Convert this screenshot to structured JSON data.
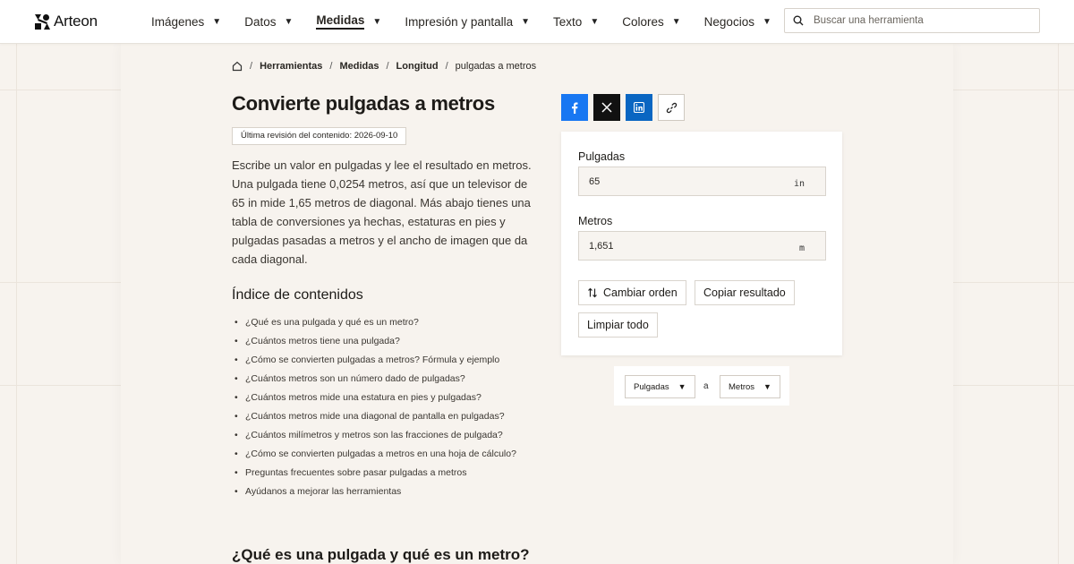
{
  "brand": {
    "name": "Arteon"
  },
  "nav": [
    {
      "label": "Imágenes",
      "active": false
    },
    {
      "label": "Datos",
      "active": false
    },
    {
      "label": "Medidas",
      "active": true
    },
    {
      "label": "Impresión y pantalla",
      "active": false
    },
    {
      "label": "Texto",
      "active": false
    },
    {
      "label": "Colores",
      "active": false
    },
    {
      "label": "Negocios",
      "active": false
    }
  ],
  "search": {
    "placeholder": "Buscar una herramienta",
    "value": ""
  },
  "breadcrumb": {
    "items": [
      "Herramientas",
      "Medidas",
      "Longitud"
    ],
    "current": "pulgadas a metros"
  },
  "page": {
    "title": "Convierte pulgadas a metros",
    "review": "Última revisión del contenido: 2026-09-10",
    "intro": "Escribe un valor en pulgadas y lee el resultado en metros. Una pulgada tiene 0,0254 metros, así que un televisor de 65 in mide 1,65 metros de diagonal. Más abajo tienes una tabla de conversiones ya hechas, estaturas en pies y pulgadas pasadas a metros y el ancho de imagen que da cada diagonal.",
    "toc_title": "Índice de contenidos",
    "toc": [
      "¿Qué es una pulgada y qué es un metro?",
      "¿Cuántos metros tiene una pulgada?",
      "¿Cómo se convierten pulgadas a metros? Fórmula y ejemplo",
      "¿Cuántos metros son un número dado de pulgadas?",
      "¿Cuántos metros mide una estatura en pies y pulgadas?",
      "¿Cuántos metros mide una diagonal de pantalla en pulgadas?",
      "¿Cuántos milímetros y metros son las fracciones de pulgada?",
      "¿Cómo se convierten pulgadas a metros en una hoja de cálculo?",
      "Preguntas frecuentes sobre pasar pulgadas a metros",
      "Ayúdanos a mejorar las herramientas"
    ],
    "section_title": "¿Qué es una pulgada y qué es un metro?"
  },
  "converter": {
    "input_label": "Pulgadas",
    "input_value": "65",
    "input_unit": "in",
    "output_label": "Metros",
    "output_value": "1,651",
    "output_unit": "m",
    "swap_label": "Cambiar orden",
    "copy_label": "Copiar resultado",
    "clear_label": "Limpiar todo"
  },
  "unit_selector": {
    "from": "Pulgadas",
    "between": "a",
    "to": "Metros"
  },
  "colors": {
    "background": "#f7f3ee",
    "facebook": "#1877f2",
    "x": "#111111",
    "linkedin": "#0a66c2"
  }
}
